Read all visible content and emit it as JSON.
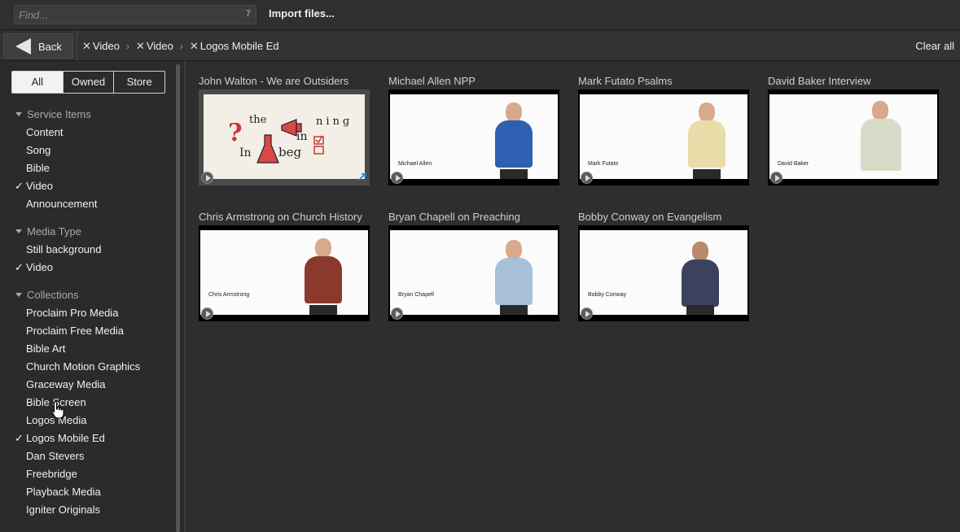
{
  "topbar": {
    "find_placeholder": "Find...",
    "find_count": "7",
    "import_label": "Import files..."
  },
  "navbar": {
    "back_label": "Back",
    "crumbs": [
      "Video",
      "Video",
      "Logos Mobile Ed"
    ],
    "clear_all": "Clear all"
  },
  "filters": {
    "tabs": [
      "All",
      "Owned",
      "Store"
    ],
    "active_tab": "All"
  },
  "sidebar": {
    "service_items": {
      "title": "Service Items",
      "items": [
        "Content",
        "Song",
        "Bible",
        "Video",
        "Announcement"
      ]
    },
    "media_type": {
      "title": "Media Type",
      "items": [
        "Still background",
        "Video"
      ]
    },
    "collections": {
      "title": "Collections",
      "items": [
        "Proclaim Pro Media",
        "Proclaim Free Media",
        "Bible Art",
        "Church Motion Graphics",
        "Graceway Media",
        "Bible Screen",
        "Logos Media",
        "Logos Mobile Ed",
        "Dan Stevers",
        "Freebridge",
        "Playback Media",
        "Igniter Originals"
      ]
    },
    "check_mark": "✓"
  },
  "tiles": [
    {
      "title": "John Walton - We are Outsiders",
      "caption": "",
      "doodle": [
        "the",
        "In",
        "beg",
        "in",
        "ning",
        "?"
      ]
    },
    {
      "title": "Michael Allen NPP",
      "caption": "Michael Allen",
      "shirt": "#2f5fb0"
    },
    {
      "title": "Mark Futato Psalms",
      "caption": "Mark Futato",
      "shirt": "#e8dca8"
    },
    {
      "title": "David Baker Interview",
      "caption": "David Baker",
      "shirt": "#d6dcc8"
    },
    {
      "title": "Chris Armstrong on Church History",
      "caption": "Chris Armstrong",
      "shirt": "#8a3a2c"
    },
    {
      "title": "Bryan Chapell on Preaching",
      "caption": "Bryan Chapell",
      "shirt": "#a8bfd8"
    },
    {
      "title": "Bobby Conway on Evangelism",
      "caption": "Bobby Conway",
      "shirt": "#3a4260"
    }
  ]
}
